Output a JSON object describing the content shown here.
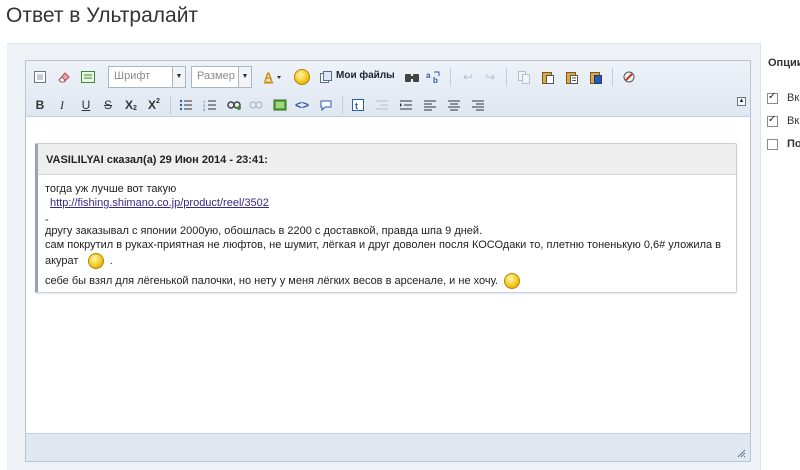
{
  "page": {
    "title": "Ответ в Ультралайт"
  },
  "toolbar": {
    "font_placeholder": "Шрифт",
    "size_placeholder": "Размер",
    "myfiles_label": "Мои файлы",
    "format_buttons": {
      "bold": "B",
      "italic": "I",
      "underline": "U",
      "strike": "S",
      "subscript": "X",
      "superscript": "X"
    }
  },
  "quote": {
    "header": "VASILILYAI сказал(а) 29 Июн 2014 - 23:41:",
    "line1": "тогда уж лучше вот такую",
    "link": "http://fishing.shimano.co.jp/product/reel/3502",
    "line_dash": "-",
    "line2": "другу заказывал с японии 2000ую, обошлась в 2200 с доставкой, правда шпа 9 дней.",
    "line3": "сам покрутил в руках-приятная не люфтов, не шумит, лёгкая и друг доволен посля КОСОдаки то, плетню тоненькую 0,6# уложила в",
    "line4": "акурат",
    "line4_end": ".",
    "line5": "себе бы взял для лёгенькой палочки, но нету у меня лёгких весов в арсенале, и не хочу."
  },
  "sidebar": {
    "title": "Опции",
    "options": [
      {
        "label": "Вк",
        "checked": true
      },
      {
        "label": "Вк",
        "checked": true
      },
      {
        "label": "По",
        "checked": false
      }
    ]
  },
  "icons": {
    "view_source": "view-source-icon",
    "eraser": "eraser-icon",
    "toggle_editor": "toggle-editor-icon",
    "text_color": "text-color-icon",
    "emoticon": "emoticon-icon",
    "myfiles": "myfiles-icon",
    "find": "find-icon",
    "replace": "replace-icon",
    "undo": "undo-icon",
    "redo": "redo-icon",
    "copy": "copy-icon",
    "paste": "paste-icon",
    "paste_text": "paste-text-icon",
    "paste_word": "paste-word-icon",
    "spellcheck": "spellcheck-icon"
  }
}
